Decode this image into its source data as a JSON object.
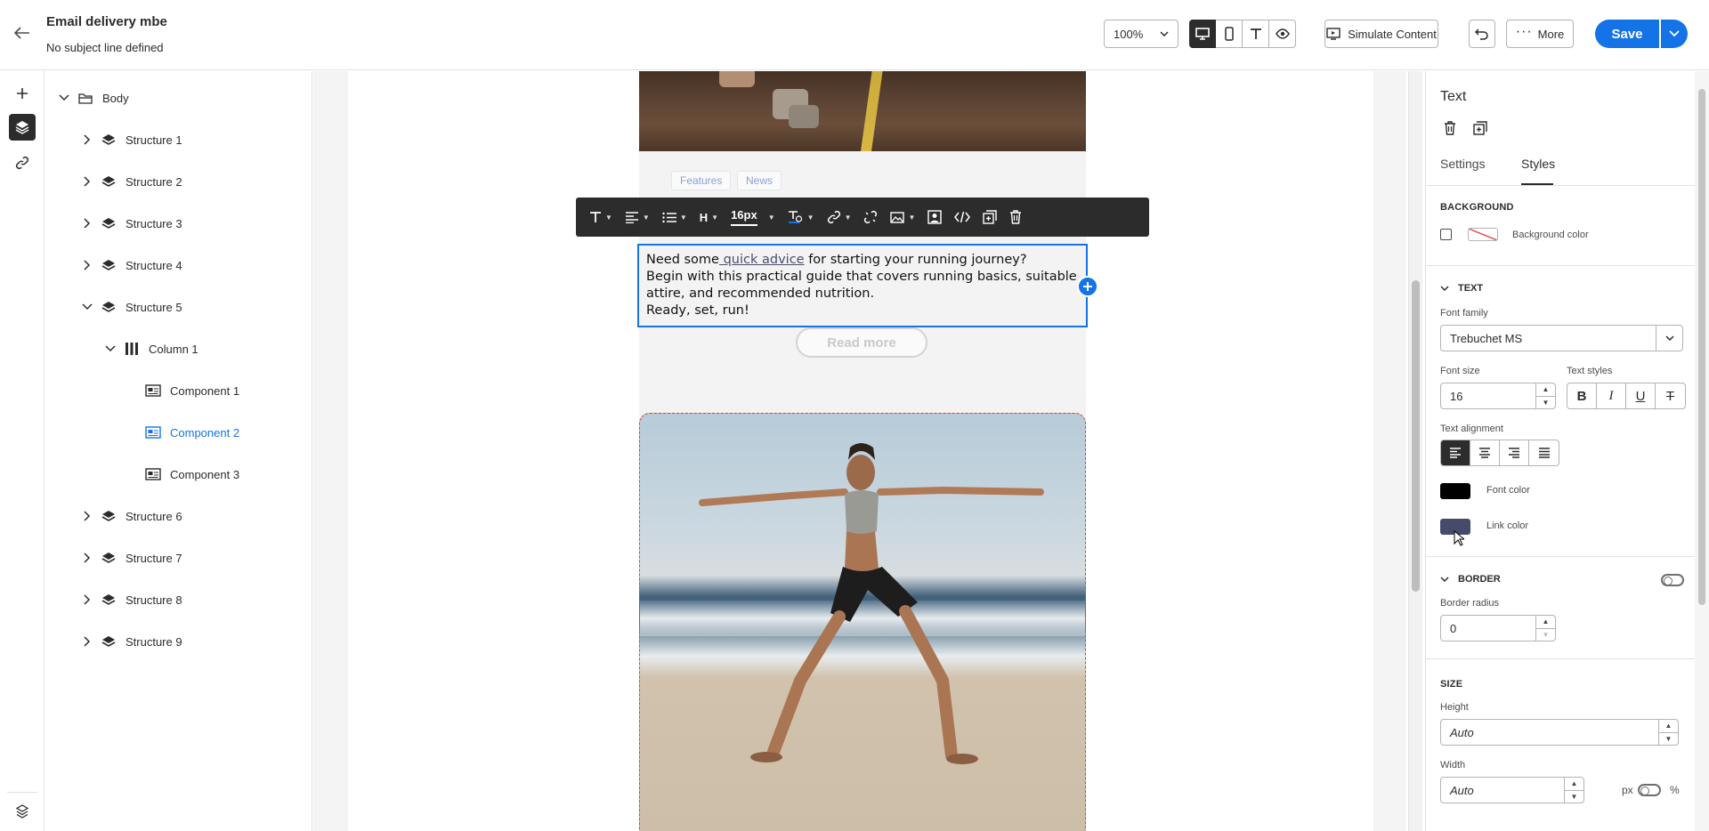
{
  "header": {
    "title": "Email delivery mbe",
    "subtitle": "No subject line defined",
    "zoom": "100%",
    "simulate_label": "Simulate Content",
    "more_label": "More",
    "save_label": "Save"
  },
  "tree": {
    "root": "Body",
    "items": [
      {
        "label": "Structure 1"
      },
      {
        "label": "Structure 2"
      },
      {
        "label": "Structure 3"
      },
      {
        "label": "Structure 4"
      },
      {
        "label": "Structure 5"
      },
      {
        "label": "Column 1"
      },
      {
        "label": "Component 1"
      },
      {
        "label": "Component 2"
      },
      {
        "label": "Component 3"
      },
      {
        "label": "Structure 6"
      },
      {
        "label": "Structure 7"
      },
      {
        "label": "Structure 8"
      },
      {
        "label": "Structure 9"
      }
    ],
    "selected": "Component 2"
  },
  "canvas": {
    "tags": [
      "Features",
      "News"
    ],
    "toolbar_font_size": "16px",
    "text": {
      "line1_before": "Need some",
      "link": " quick advice",
      "line1_after": " for starting your running journey?",
      "line2": "Begin with this practical guide that covers running basics, suitable attire, and recommended nutrition.",
      "line3": "Ready, set, run!"
    },
    "read_more": "Read more"
  },
  "props": {
    "title": "Text",
    "tabs": [
      "Settings",
      "Styles"
    ],
    "active_tab": "Styles",
    "background_header": "BACKGROUND",
    "background_color_label": "Background color",
    "text_header": "TEXT",
    "font_family_label": "Font family",
    "font_family_value": "Trebuchet MS",
    "font_size_label": "Font size",
    "font_size_value": "16",
    "text_styles_label": "Text styles",
    "text_alignment_label": "Text alignment",
    "font_color_label": "Font color",
    "link_color_label": "Link color",
    "border_header": "BORDER",
    "border_radius_label": "Border radius",
    "border_radius_value": "0",
    "size_header": "SIZE",
    "height_label": "Height",
    "height_value": "Auto",
    "width_label": "Width",
    "width_value": "Auto",
    "unit_px": "px",
    "unit_pct": "%"
  },
  "colors": {
    "accent": "#1473e6",
    "font_color": "#000000",
    "link_color": "#474b6b",
    "selected_outline": "#1473e6"
  }
}
